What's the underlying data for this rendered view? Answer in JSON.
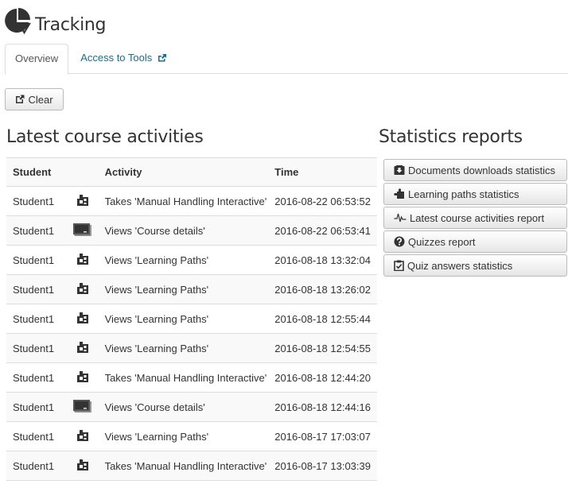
{
  "header": {
    "title": "Tracking",
    "icon": "pie-chart-icon"
  },
  "tabs": [
    {
      "label": "Overview",
      "active": true
    },
    {
      "label": "Access to Tools",
      "icon": "external-link-icon",
      "active": false
    }
  ],
  "toolbar": {
    "clear_label": "Clear",
    "clear_icon": "edit-external-icon"
  },
  "activities": {
    "title": "Latest course activities",
    "columns": [
      "Student",
      "",
      "Activity",
      "Time"
    ],
    "rows": [
      {
        "student": "Student1",
        "icon": "learning-path-icon",
        "activity": "Takes 'Manual Handling Interactive'",
        "time": "2016-08-22 06:53:52"
      },
      {
        "student": "Student1",
        "icon": "course-details-icon",
        "activity": "Views 'Course details'",
        "time": "2016-08-22 06:53:41"
      },
      {
        "student": "Student1",
        "icon": "learning-path-icon",
        "activity": "Views 'Learning Paths'",
        "time": "2016-08-18 13:32:04"
      },
      {
        "student": "Student1",
        "icon": "learning-path-icon",
        "activity": "Views 'Learning Paths'",
        "time": "2016-08-18 13:26:02"
      },
      {
        "student": "Student1",
        "icon": "learning-path-icon",
        "activity": "Views 'Learning Paths'",
        "time": "2016-08-18 12:55:44"
      },
      {
        "student": "Student1",
        "icon": "learning-path-icon",
        "activity": "Views 'Learning Paths'",
        "time": "2016-08-18 12:54:55"
      },
      {
        "student": "Student1",
        "icon": "learning-path-icon",
        "activity": "Takes 'Manual Handling Interactive'",
        "time": "2016-08-18 12:44:20"
      },
      {
        "student": "Student1",
        "icon": "course-details-icon",
        "activity": "Views 'Course details'",
        "time": "2016-08-18 12:44:16"
      },
      {
        "student": "Student1",
        "icon": "learning-path-icon",
        "activity": "Views 'Learning Paths'",
        "time": "2016-08-17 17:03:07"
      },
      {
        "student": "Student1",
        "icon": "learning-path-icon",
        "activity": "Takes 'Manual Handling Interactive'",
        "time": "2016-08-17 13:03:39"
      }
    ]
  },
  "reports": {
    "title": "Statistics reports",
    "items": [
      {
        "label": "Documents downloads statistics",
        "icon": "download-box-icon"
      },
      {
        "label": "Learning paths statistics",
        "icon": "puzzle-icon"
      },
      {
        "label": "Latest course activities report",
        "icon": "pulse-icon"
      },
      {
        "label": "Quizzes report",
        "icon": "question-circle-icon"
      },
      {
        "label": "Quiz answers statistics",
        "icon": "clipboard-check-icon"
      }
    ]
  },
  "colors": {
    "link": "#1a6d8f",
    "text": "#333333",
    "border": "#dddddd",
    "stripe": "#f9f9f9"
  }
}
